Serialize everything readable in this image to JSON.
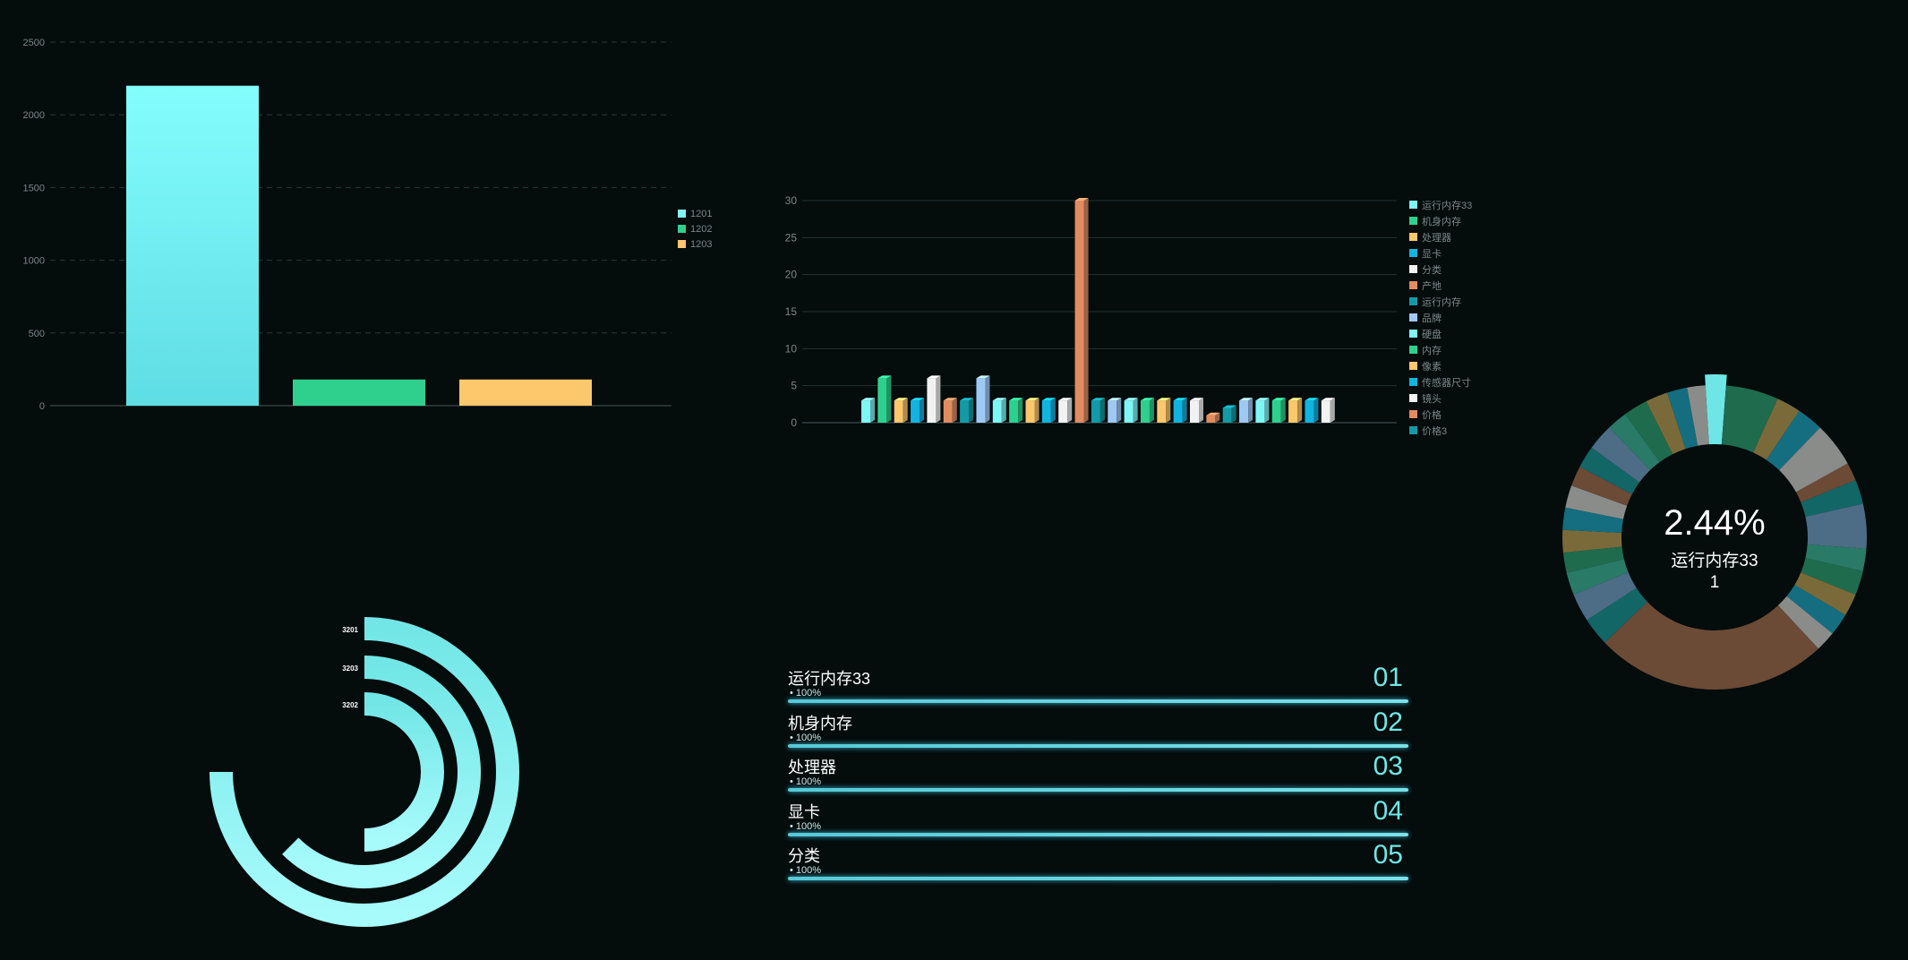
{
  "colors": {
    "background": "#040c0c",
    "cyan": "#7ff6f6",
    "green": "#2fd08e",
    "yellow": "#fdc76b",
    "blue": "#11b3e0",
    "white": "#f2f2f2",
    "orange": "#e08c60",
    "teal": "#139aa6",
    "lightblue": "#9ec9f5"
  },
  "chart_data": [
    {
      "type": "bar",
      "categories": [
        "1201",
        "1202",
        "1203"
      ],
      "values": [
        2200,
        180,
        180
      ],
      "ylim": [
        0,
        2500
      ],
      "yticks": [
        "0",
        "500",
        "1000",
        "1500",
        "2000",
        "2500"
      ],
      "grid": true,
      "legend": [
        "1201",
        "1202",
        "1203"
      ],
      "legend_placement": "right",
      "series_colors": [
        "#7ff6f6",
        "#2fd08e",
        "#fdc76b"
      ]
    },
    {
      "type": "bar",
      "ylim": [
        0,
        30
      ],
      "yticks": [
        "0",
        "5",
        "10",
        "15",
        "20",
        "25",
        "30"
      ],
      "grid": true,
      "legend": [
        "运行内存33",
        "机身内存",
        "处理器",
        "显卡",
        "分类",
        "产地",
        "运行内存",
        "品牌",
        "硬盘",
        "内存",
        "像素",
        "传感器尺寸",
        "镜头",
        "价格",
        "价格3"
      ],
      "legend_colors": [
        "#7ff6f6",
        "#2fd08e",
        "#fdc76b",
        "#11b3e0",
        "#f2f2f2",
        "#e08c60",
        "#139aa6",
        "#9ec9f5",
        "#7ff6f6",
        "#2fd08e",
        "#fdc76b",
        "#11b3e0",
        "#f2f2f2",
        "#e08c60",
        "#139aa6"
      ],
      "legend_placement": "right",
      "values": [
        3,
        6,
        3,
        3,
        6,
        3,
        3,
        6,
        3,
        3,
        3,
        3,
        3,
        30,
        3,
        3,
        3,
        3,
        3,
        3,
        3,
        1,
        2,
        3,
        3,
        3,
        3,
        3,
        3
      ],
      "bar_colors": [
        "#7ff6f6",
        "#2fd08e",
        "#fdc76b",
        "#11b3e0",
        "#f2f2f2",
        "#e08c60",
        "#139aa6",
        "#9ec9f5",
        "#7ff6f6",
        "#2fd08e",
        "#fdc76b",
        "#11b3e0",
        "#f2f2f2",
        "#e08c60",
        "#139aa6",
        "#9ec9f5",
        "#7ff6f6",
        "#2fd08e",
        "#fdc76b",
        "#11b3e0",
        "#f2f2f2",
        "#e08c60",
        "#139aa6",
        "#9ec9f5",
        "#7ff6f6",
        "#2fd08e",
        "#fdc76b",
        "#11b3e0",
        "#f2f2f2"
      ]
    },
    {
      "type": "radial-bar",
      "series": [
        {
          "name": "3201",
          "fraction": 0.75
        },
        {
          "name": "3203",
          "fraction": 0.625
        },
        {
          "name": "3202",
          "fraction": 0.5
        }
      ]
    },
    {
      "type": "pie",
      "center_value": "2.44%",
      "center_label": "运行内存33",
      "center_sub": "1",
      "slices": [
        {
          "value": 1,
          "color": "#6fe6e6",
          "highlight": true
        },
        {
          "value": 2.6,
          "color": "#1f6b4e"
        },
        {
          "value": 1.2,
          "color": "#7a6a3a"
        },
        {
          "value": 1.3,
          "color": "#146e80"
        },
        {
          "value": 2.2,
          "color": "#8a8c8a"
        },
        {
          "value": 0.9,
          "color": "#6b4a36"
        },
        {
          "value": 1.2,
          "color": "#136666"
        },
        {
          "value": 2.2,
          "color": "#4d6c86"
        },
        {
          "value": 1.1,
          "color": "#2a7a68"
        },
        {
          "value": 1.2,
          "color": "#1f6b4e"
        },
        {
          "value": 1.1,
          "color": "#7a6a3a"
        },
        {
          "value": 1.1,
          "color": "#146e80"
        },
        {
          "value": 1.0,
          "color": "#8a8c8a"
        },
        {
          "value": 11.5,
          "color": "#6b4a36"
        },
        {
          "value": 1.4,
          "color": "#136666"
        },
        {
          "value": 1.4,
          "color": "#4d6c86"
        },
        {
          "value": 1.1,
          "color": "#2a7a68"
        },
        {
          "value": 1.0,
          "color": "#1f6b4e"
        },
        {
          "value": 1.1,
          "color": "#7a6a3a"
        },
        {
          "value": 1.1,
          "color": "#146e80"
        },
        {
          "value": 1.1,
          "color": "#8a8c8a"
        },
        {
          "value": 1.0,
          "color": "#6b4a36"
        },
        {
          "value": 1.1,
          "color": "#136666"
        },
        {
          "value": 1.3,
          "color": "#4d6c86"
        },
        {
          "value": 1.0,
          "color": "#2a7a68"
        },
        {
          "value": 1.2,
          "color": "#1f6b4e"
        },
        {
          "value": 1.1,
          "color": "#7a6a3a"
        },
        {
          "value": 1.0,
          "color": "#146e80"
        },
        {
          "value": 0.9,
          "color": "#8a8c8a"
        }
      ]
    }
  ],
  "ranking": [
    {
      "name": "运行内存33",
      "pct": "• 100%",
      "no": "01",
      "fraction": 1.0
    },
    {
      "name": "机身内存",
      "pct": "• 100%",
      "no": "02",
      "fraction": 1.0
    },
    {
      "name": "处理器",
      "pct": "• 100%",
      "no": "03",
      "fraction": 1.0
    },
    {
      "name": "显卡",
      "pct": "• 100%",
      "no": "04",
      "fraction": 1.0
    },
    {
      "name": "分类",
      "pct": "• 100%",
      "no": "05",
      "fraction": 1.0
    }
  ]
}
